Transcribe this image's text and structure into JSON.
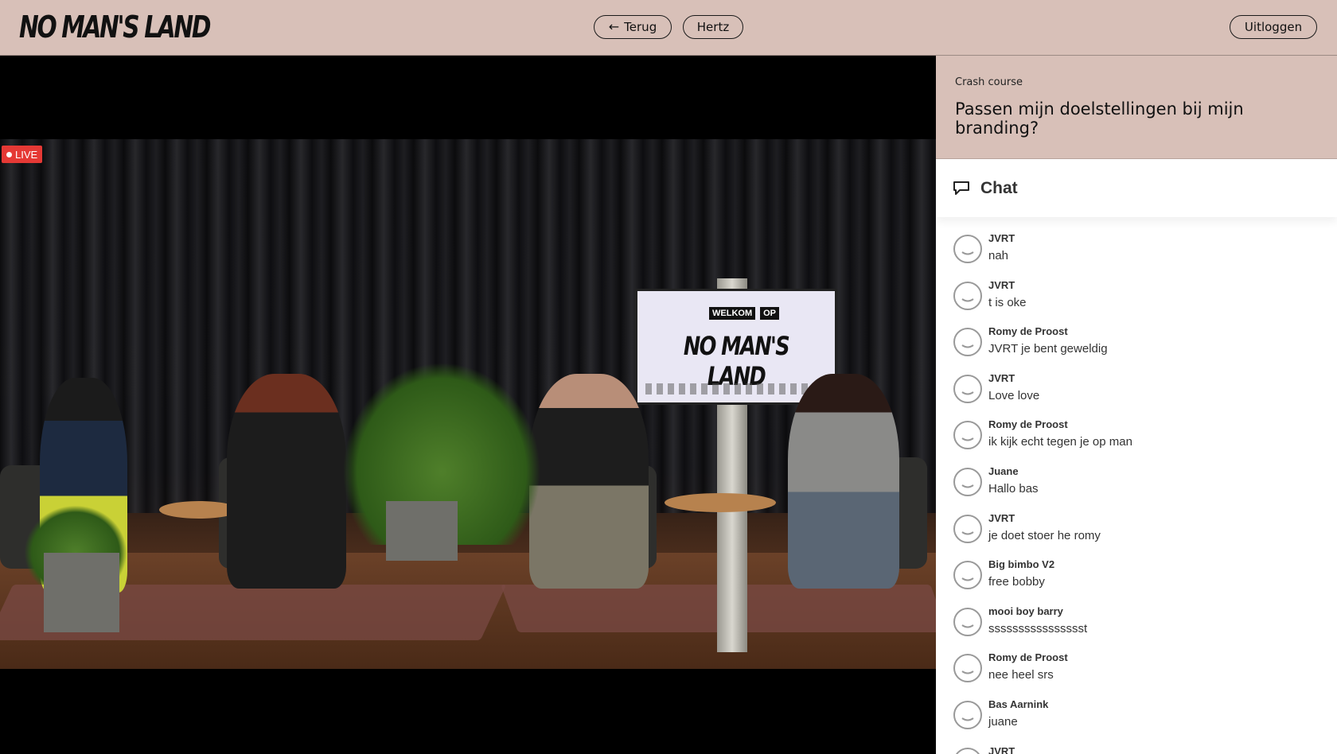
{
  "header": {
    "logo": "NO MAN'S LAND",
    "back_label": "Terug",
    "back_icon": "arrow-left-icon",
    "room_label": "Hertz",
    "logout_label": "Uitloggen"
  },
  "video": {
    "live_label": "LIVE",
    "screen_welcome": [
      "WELKOM",
      "OP"
    ],
    "screen_title": "NO MAN'S LAND"
  },
  "session": {
    "kicker": "Crash course",
    "title": "Passen mijn doelstellingen bij mijn branding?"
  },
  "chat": {
    "title": "Chat",
    "icon": "speech-bubble-icon",
    "messages": [
      {
        "user": "JVRT",
        "text": "nah"
      },
      {
        "user": "JVRT",
        "text": "t is oke"
      },
      {
        "user": "Romy de Proost",
        "text": "JVRT je bent geweldig"
      },
      {
        "user": "JVRT",
        "text": "Love love"
      },
      {
        "user": "Romy de Proost",
        "text": "ik kijk echt tegen je op man"
      },
      {
        "user": "Juane",
        "text": "Hallo bas"
      },
      {
        "user": "JVRT",
        "text": "je doet stoer he romy"
      },
      {
        "user": "Big bimbo V2",
        "text": "free bobby"
      },
      {
        "user": "mooi boy barry",
        "text": "sssssssssssssssst"
      },
      {
        "user": "Romy de Proost",
        "text": "nee heel srs"
      },
      {
        "user": "Bas Aarnink",
        "text": "juane"
      },
      {
        "user": "JVRT",
        "text": ""
      }
    ]
  },
  "colors": {
    "header_bg": "#d8c0b8",
    "live_red": "#e53935",
    "text_dark": "#333333"
  }
}
